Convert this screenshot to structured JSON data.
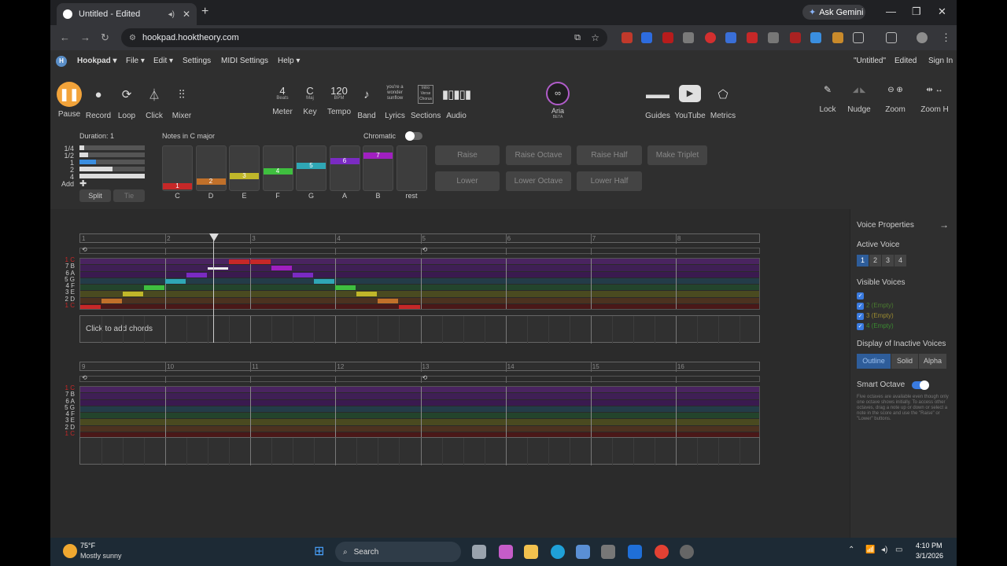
{
  "browser": {
    "tab_title": "Untitled - Edited",
    "url": "hookpad.hooktheory.com",
    "ask_gemini": "Ask Gemini"
  },
  "menu": {
    "app": "Hookpad",
    "items": [
      "File",
      "Edit",
      "Settings",
      "MIDI Settings",
      "Help"
    ],
    "doc_title": "\"Untitled\"",
    "doc_status": "Edited",
    "sign_in": "Sign In"
  },
  "toolbar": {
    "pause": "Pause",
    "record": "Record",
    "loop": "Loop",
    "click": "Click",
    "mixer": "Mixer",
    "meter_value": "4",
    "meter_unit": "Beats",
    "meter": "Meter",
    "key_value": "C",
    "key_unit": "Maj",
    "key": "Key",
    "tempo_value": "120",
    "tempo_unit": "BPM",
    "tempo": "Tempo",
    "band": "Band",
    "lyrics_icon_text": "you're a wonder sunflow",
    "lyrics": "Lyrics",
    "sections_icon_text": "Intro Verse Chorus",
    "sections": "Sections",
    "audio": "Audio",
    "aria": "Aria",
    "aria_beta": "BETA",
    "guides": "Guides",
    "youtube": "YouTube",
    "metrics": "Metrics",
    "lock": "Lock",
    "nudge": "Nudge",
    "zoom": "Zoom",
    "zoomh": "Zoom H"
  },
  "notes_panel": {
    "duration_label": "Duration: 1",
    "durations": [
      "1/4",
      "1/2",
      "1",
      "2",
      "4",
      "Add"
    ],
    "split": "Split",
    "tie": "Tie",
    "scale_label": "Notes in C major",
    "chromatic": "Chromatic",
    "keys": [
      {
        "degree": "1",
        "name": "C",
        "color": "#c62828"
      },
      {
        "degree": "2",
        "name": "D",
        "color": "#c0702a"
      },
      {
        "degree": "3",
        "name": "E",
        "color": "#c0b72a"
      },
      {
        "degree": "4",
        "name": "F",
        "color": "#3fbf3f"
      },
      {
        "degree": "5",
        "name": "G",
        "color": "#2fa7b5"
      },
      {
        "degree": "6",
        "name": "A",
        "color": "#7a2bc2"
      },
      {
        "degree": "7",
        "name": "B",
        "color": "#a020c0"
      },
      {
        "degree": "",
        "name": "rest",
        "color": ""
      }
    ],
    "ops": [
      "Raise",
      "Raise Octave",
      "Raise Half",
      "Make Triplet",
      "Lower",
      "Lower Octave",
      "Lower Half"
    ]
  },
  "score": {
    "row1_measures": [
      "1",
      "2",
      "3",
      "4",
      "5",
      "6",
      "7",
      "8"
    ],
    "row2_measures": [
      "9",
      "10",
      "11",
      "12",
      "13",
      "14",
      "15",
      "16"
    ],
    "pitch_labels": [
      "1 C",
      "7 B",
      "6 A",
      "5 G",
      "4 F",
      "3 E",
      "2 D",
      "1 C"
    ],
    "chord_placeholder": "Click to add chords",
    "melody": [
      {
        "beat": 0,
        "degree": 1
      },
      {
        "beat": 1,
        "degree": 2
      },
      {
        "beat": 2,
        "degree": 3
      },
      {
        "beat": 3,
        "degree": 4
      },
      {
        "beat": 4,
        "degree": 5
      },
      {
        "beat": 5,
        "degree": 6
      },
      {
        "beat": 6,
        "degree": 7
      },
      {
        "beat": 7,
        "degree": 8
      },
      {
        "beat": 8,
        "degree": 8
      },
      {
        "beat": 9,
        "degree": 7
      },
      {
        "beat": 10,
        "degree": 6
      },
      {
        "beat": 11,
        "degree": 5
      },
      {
        "beat": 12,
        "degree": 4
      },
      {
        "beat": 13,
        "degree": 3
      },
      {
        "beat": 14,
        "degree": 2
      },
      {
        "beat": 15,
        "degree": 1
      }
    ]
  },
  "voice_panel": {
    "title": "Voice Properties",
    "active_voice": "Active Voice",
    "voices": [
      "1",
      "2",
      "3",
      "4"
    ],
    "visible_voices": "Visible Voices",
    "visible": [
      "",
      "2 (Empty)",
      "3 (Empty)",
      "4 (Empty)"
    ],
    "display_inactive": "Display of Inactive Voices",
    "display_opts": [
      "Outline",
      "Solid",
      "Alpha"
    ],
    "smart_octave": "Smart Octave",
    "smart_help": "Five octaves are available even though only one octave shows initially. To access other octaves, drag a note up or down or select a note in the score and use the \"Raise\" or \"Lower\" buttons."
  },
  "taskbar": {
    "temp": "75°F",
    "weather": "Mostly sunny",
    "search": "Search",
    "time": "4:10 PM",
    "date": "3/1/2026"
  }
}
